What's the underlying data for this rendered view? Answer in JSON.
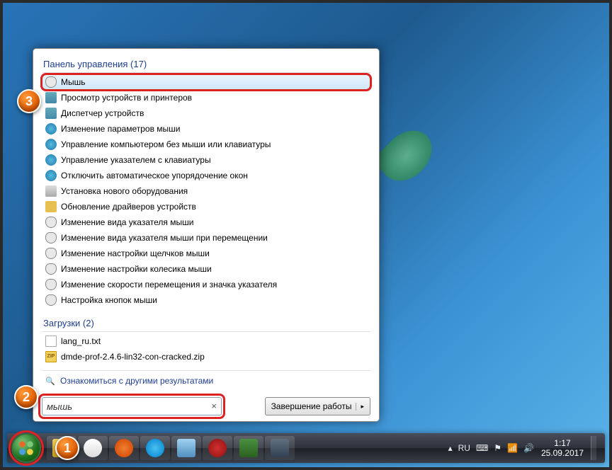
{
  "categories": {
    "control_panel": {
      "label": "Панель управления (17)"
    },
    "downloads": {
      "label": "Загрузки (2)"
    }
  },
  "results": {
    "cp": [
      {
        "label": "Мышь",
        "icon": "mouse",
        "selected": true,
        "highlight": true
      },
      {
        "label": "Просмотр устройств и принтеров",
        "icon": "dev"
      },
      {
        "label": "Диспетчер устройств",
        "icon": "dev"
      },
      {
        "label": "Изменение параметров мыши",
        "icon": "ease"
      },
      {
        "label": "Управление компьютером без мыши или клавиатуры",
        "icon": "ease"
      },
      {
        "label": "Управление указателем с клавиатуры",
        "icon": "ease"
      },
      {
        "label": "Отключить автоматическое упорядочение окон",
        "icon": "ease"
      },
      {
        "label": "Установка нового оборудования",
        "icon": "hw"
      },
      {
        "label": "Обновление драйверов устройств",
        "icon": "upd"
      },
      {
        "label": "Изменение вида указателя мыши",
        "icon": "mouse"
      },
      {
        "label": "Изменение вида указателя мыши при перемещении",
        "icon": "mouse"
      },
      {
        "label": "Изменение настройки щелчков мыши",
        "icon": "mouse"
      },
      {
        "label": "Изменение настройки колесика мыши",
        "icon": "mouse"
      },
      {
        "label": "Изменение скорости перемещения и значка указателя",
        "icon": "mouse"
      },
      {
        "label": "Настройка кнопок мыши",
        "icon": "mouse"
      }
    ],
    "dl": [
      {
        "label": "lang_ru.txt",
        "icon": "file"
      },
      {
        "label": "dmde-prof-2.4.6-lin32-con-cracked.zip",
        "icon": "zip"
      }
    ]
  },
  "more_results": "Ознакомиться с другими результатами",
  "search": {
    "value": "мышь",
    "clear": "×"
  },
  "shutdown": {
    "label": "Завершение работы",
    "arrow": "▸"
  },
  "tray": {
    "lang": "RU",
    "time": "1:17",
    "date": "25.09.2017"
  },
  "markers": {
    "m1": "1",
    "m2": "2",
    "m3": "3"
  }
}
